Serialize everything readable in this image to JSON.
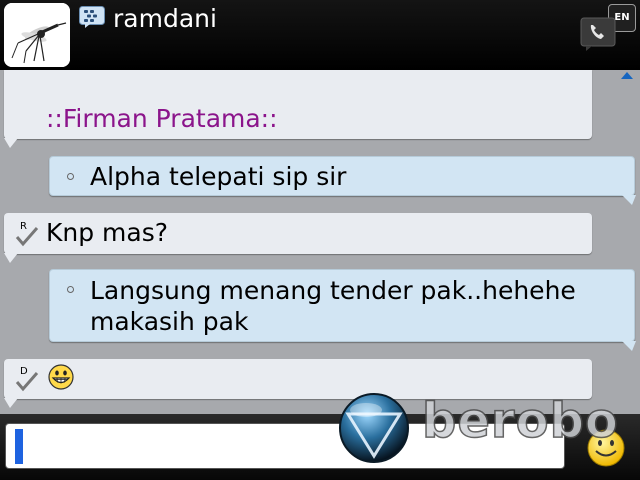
{
  "header": {
    "contact_name": "ramdani",
    "language": "EN",
    "icons": [
      "mosquito-avatar",
      "bbm-icon",
      "phone-icon"
    ]
  },
  "messages": [
    {
      "direction": "incoming",
      "sender": "::Firman Pratama::"
    },
    {
      "direction": "outgoing",
      "text_lines": [
        "Alpha telepati sip sir"
      ]
    },
    {
      "direction": "incoming",
      "status": "R",
      "text_lines": [
        "Knp mas?"
      ]
    },
    {
      "direction": "outgoing",
      "text_lines": [
        "Langsung menang tender pak..hehehe",
        "makasih pak"
      ]
    },
    {
      "direction": "incoming",
      "status": "D",
      "emoticon": "grin-emoticon"
    }
  ],
  "composer": {
    "value": "",
    "emoticon_button": "smiley-icon"
  },
  "watermark": {
    "text": "berobo"
  },
  "colors": {
    "background": "#a7a9ad",
    "sender_name": "#8b148b",
    "outgoing_bubble": "#d2e5f3",
    "incoming_bubble": "#e9ecf1",
    "caret": "#1e63e0"
  }
}
